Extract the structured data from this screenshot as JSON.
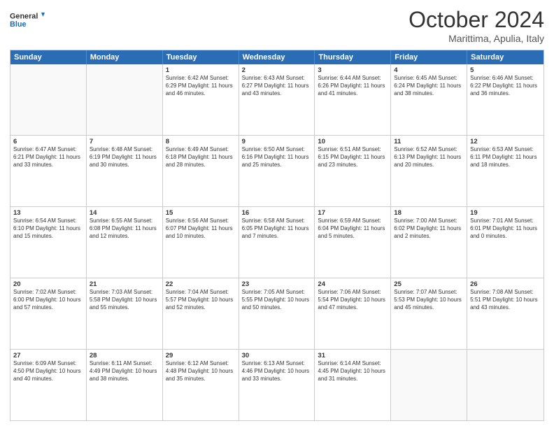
{
  "header": {
    "logo_line1": "General",
    "logo_line2": "Blue",
    "month": "October 2024",
    "location": "Marittima, Apulia, Italy"
  },
  "weekdays": [
    "Sunday",
    "Monday",
    "Tuesday",
    "Wednesday",
    "Thursday",
    "Friday",
    "Saturday"
  ],
  "rows": [
    [
      {
        "day": "",
        "text": ""
      },
      {
        "day": "",
        "text": ""
      },
      {
        "day": "1",
        "text": "Sunrise: 6:42 AM\nSunset: 6:29 PM\nDaylight: 11 hours and 46 minutes."
      },
      {
        "day": "2",
        "text": "Sunrise: 6:43 AM\nSunset: 6:27 PM\nDaylight: 11 hours and 43 minutes."
      },
      {
        "day": "3",
        "text": "Sunrise: 6:44 AM\nSunset: 6:26 PM\nDaylight: 11 hours and 41 minutes."
      },
      {
        "day": "4",
        "text": "Sunrise: 6:45 AM\nSunset: 6:24 PM\nDaylight: 11 hours and 38 minutes."
      },
      {
        "day": "5",
        "text": "Sunrise: 6:46 AM\nSunset: 6:22 PM\nDaylight: 11 hours and 36 minutes."
      }
    ],
    [
      {
        "day": "6",
        "text": "Sunrise: 6:47 AM\nSunset: 6:21 PM\nDaylight: 11 hours and 33 minutes."
      },
      {
        "day": "7",
        "text": "Sunrise: 6:48 AM\nSunset: 6:19 PM\nDaylight: 11 hours and 30 minutes."
      },
      {
        "day": "8",
        "text": "Sunrise: 6:49 AM\nSunset: 6:18 PM\nDaylight: 11 hours and 28 minutes."
      },
      {
        "day": "9",
        "text": "Sunrise: 6:50 AM\nSunset: 6:16 PM\nDaylight: 11 hours and 25 minutes."
      },
      {
        "day": "10",
        "text": "Sunrise: 6:51 AM\nSunset: 6:15 PM\nDaylight: 11 hours and 23 minutes."
      },
      {
        "day": "11",
        "text": "Sunrise: 6:52 AM\nSunset: 6:13 PM\nDaylight: 11 hours and 20 minutes."
      },
      {
        "day": "12",
        "text": "Sunrise: 6:53 AM\nSunset: 6:11 PM\nDaylight: 11 hours and 18 minutes."
      }
    ],
    [
      {
        "day": "13",
        "text": "Sunrise: 6:54 AM\nSunset: 6:10 PM\nDaylight: 11 hours and 15 minutes."
      },
      {
        "day": "14",
        "text": "Sunrise: 6:55 AM\nSunset: 6:08 PM\nDaylight: 11 hours and 12 minutes."
      },
      {
        "day": "15",
        "text": "Sunrise: 6:56 AM\nSunset: 6:07 PM\nDaylight: 11 hours and 10 minutes."
      },
      {
        "day": "16",
        "text": "Sunrise: 6:58 AM\nSunset: 6:05 PM\nDaylight: 11 hours and 7 minutes."
      },
      {
        "day": "17",
        "text": "Sunrise: 6:59 AM\nSunset: 6:04 PM\nDaylight: 11 hours and 5 minutes."
      },
      {
        "day": "18",
        "text": "Sunrise: 7:00 AM\nSunset: 6:02 PM\nDaylight: 11 hours and 2 minutes."
      },
      {
        "day": "19",
        "text": "Sunrise: 7:01 AM\nSunset: 6:01 PM\nDaylight: 11 hours and 0 minutes."
      }
    ],
    [
      {
        "day": "20",
        "text": "Sunrise: 7:02 AM\nSunset: 6:00 PM\nDaylight: 10 hours and 57 minutes."
      },
      {
        "day": "21",
        "text": "Sunrise: 7:03 AM\nSunset: 5:58 PM\nDaylight: 10 hours and 55 minutes."
      },
      {
        "day": "22",
        "text": "Sunrise: 7:04 AM\nSunset: 5:57 PM\nDaylight: 10 hours and 52 minutes."
      },
      {
        "day": "23",
        "text": "Sunrise: 7:05 AM\nSunset: 5:55 PM\nDaylight: 10 hours and 50 minutes."
      },
      {
        "day": "24",
        "text": "Sunrise: 7:06 AM\nSunset: 5:54 PM\nDaylight: 10 hours and 47 minutes."
      },
      {
        "day": "25",
        "text": "Sunrise: 7:07 AM\nSunset: 5:53 PM\nDaylight: 10 hours and 45 minutes."
      },
      {
        "day": "26",
        "text": "Sunrise: 7:08 AM\nSunset: 5:51 PM\nDaylight: 10 hours and 43 minutes."
      }
    ],
    [
      {
        "day": "27",
        "text": "Sunrise: 6:09 AM\nSunset: 4:50 PM\nDaylight: 10 hours and 40 minutes."
      },
      {
        "day": "28",
        "text": "Sunrise: 6:11 AM\nSunset: 4:49 PM\nDaylight: 10 hours and 38 minutes."
      },
      {
        "day": "29",
        "text": "Sunrise: 6:12 AM\nSunset: 4:48 PM\nDaylight: 10 hours and 35 minutes."
      },
      {
        "day": "30",
        "text": "Sunrise: 6:13 AM\nSunset: 4:46 PM\nDaylight: 10 hours and 33 minutes."
      },
      {
        "day": "31",
        "text": "Sunrise: 6:14 AM\nSunset: 4:45 PM\nDaylight: 10 hours and 31 minutes."
      },
      {
        "day": "",
        "text": ""
      },
      {
        "day": "",
        "text": ""
      }
    ]
  ]
}
